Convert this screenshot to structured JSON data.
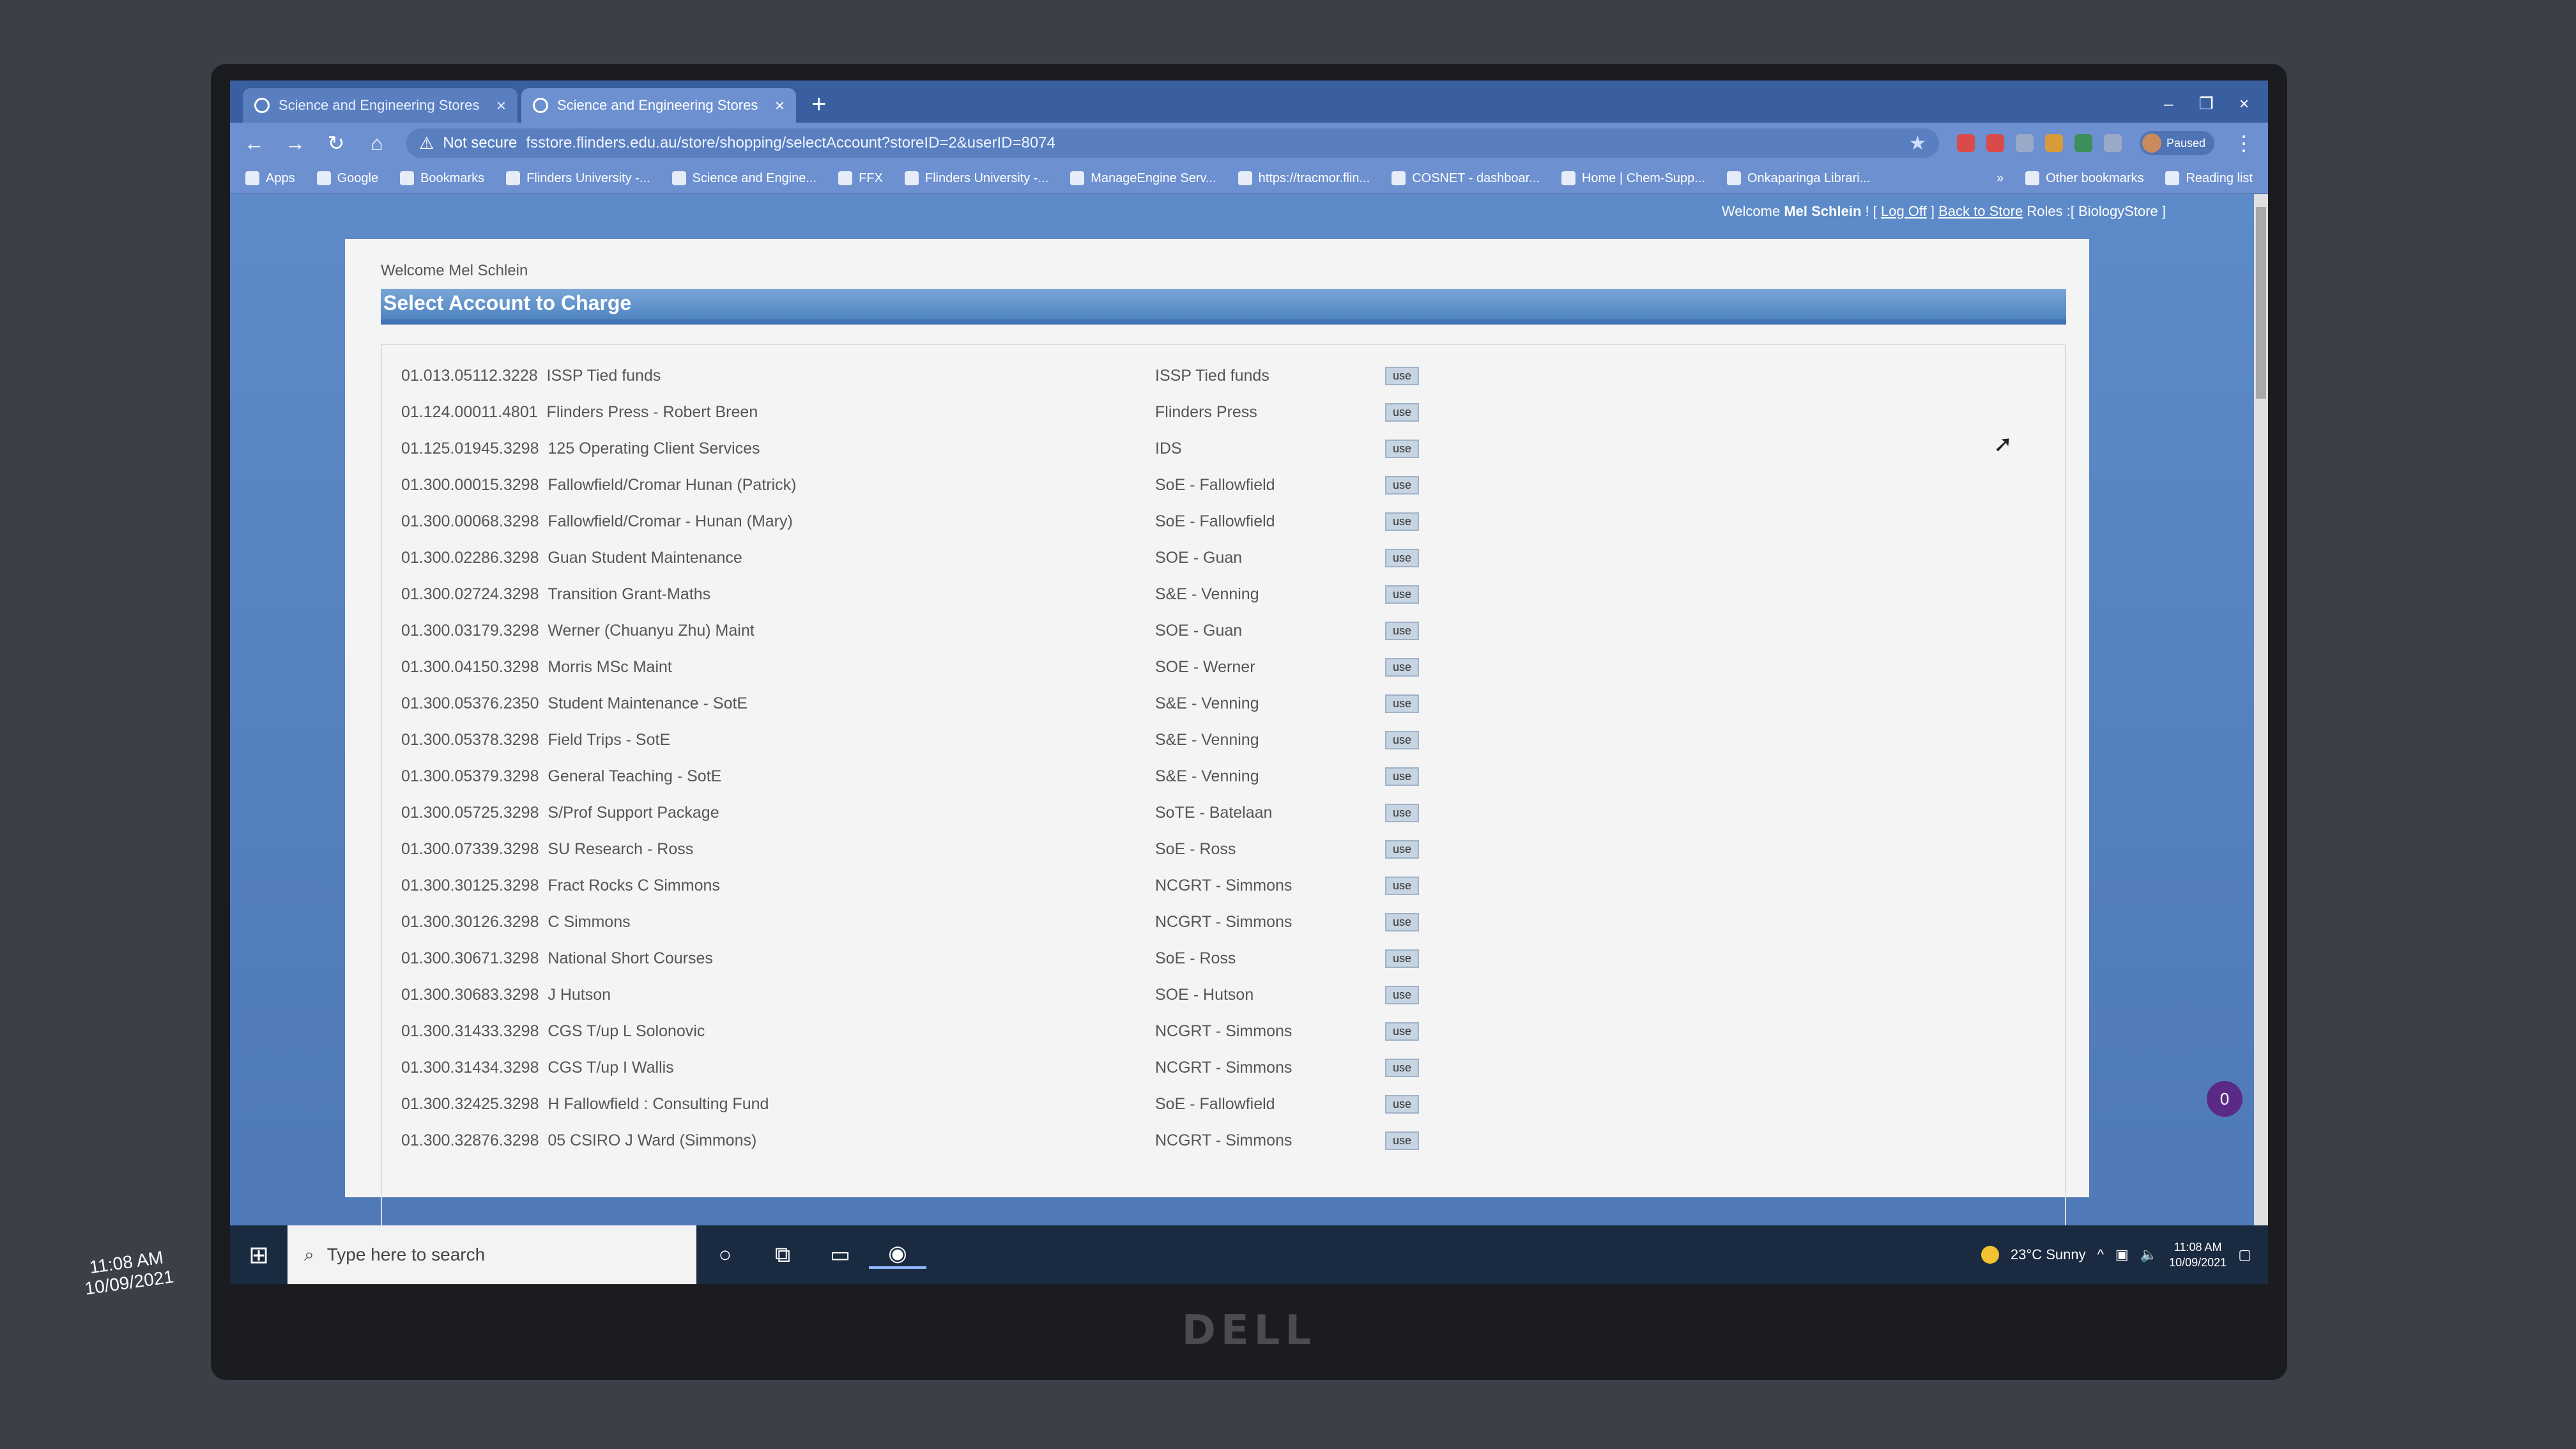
{
  "browser": {
    "tabs": [
      {
        "label": "Science and Engineering Stores",
        "close": "×"
      },
      {
        "label": "Science and Engineering Stores",
        "close": "×"
      }
    ],
    "new_tab": "+",
    "window_controls": [
      "–",
      "❐",
      "×"
    ],
    "security_label": "Not secure",
    "url": "fsstore.flinders.edu.au/store/shopping/selectAccount?storeID=2&userID=8074",
    "profile_label": "Paused",
    "bookmarks": [
      "Apps",
      "Google",
      "Bookmarks",
      "Flinders University -...",
      "Science and Engine...",
      "FFX",
      "Flinders University -...",
      "ManageEngine Serv...",
      "https://tracmor.flin...",
      "COSNET - dashboar...",
      "Home | Chem-Supp...",
      "Onkaparinga Librari..."
    ],
    "bookmarks_more": "»",
    "other_bookmarks": "Other bookmarks",
    "reading_list": "Reading list"
  },
  "header": {
    "welcome_prefix": "Welcome",
    "user": "Mel Schlein",
    "sep1": "! [",
    "logoff": "Log Off",
    "sep2": "]",
    "back_to_store": "Back to Store",
    "roles": "Roles :[ BiologyStore ]"
  },
  "panel": {
    "welcome": "Welcome Mel Schlein",
    "title": "Select Account to Charge",
    "use_label": "use",
    "accounts": [
      {
        "code": "01.013.05112.3228",
        "name": "ISSP Tied funds",
        "group": "ISSP Tied funds"
      },
      {
        "code": "01.124.00011.4801",
        "name": "Flinders Press - Robert Breen",
        "group": "Flinders Press"
      },
      {
        "code": "01.125.01945.3298",
        "name": "125 Operating Client Services",
        "group": "IDS"
      },
      {
        "code": "01.300.00015.3298",
        "name": "Fallowfield/Cromar Hunan (Patrick)",
        "group": "SoE - Fallowfield"
      },
      {
        "code": "01.300.00068.3298",
        "name": "Fallowfield/Cromar - Hunan (Mary)",
        "group": "SoE - Fallowfield"
      },
      {
        "code": "01.300.02286.3298",
        "name": "Guan Student Maintenance",
        "group": "SOE - Guan"
      },
      {
        "code": "01.300.02724.3298",
        "name": "Transition Grant-Maths",
        "group": "S&E - Venning"
      },
      {
        "code": "01.300.03179.3298",
        "name": "Werner (Chuanyu Zhu) Maint",
        "group": "SOE - Guan"
      },
      {
        "code": "01.300.04150.3298",
        "name": "Morris MSc Maint",
        "group": "SOE - Werner"
      },
      {
        "code": "01.300.05376.2350",
        "name": "Student Maintenance - SotE",
        "group": "S&E - Venning"
      },
      {
        "code": "01.300.05378.3298",
        "name": "Field Trips - SotE",
        "group": "S&E - Venning"
      },
      {
        "code": "01.300.05379.3298",
        "name": "General Teaching - SotE",
        "group": "S&E - Venning"
      },
      {
        "code": "01.300.05725.3298",
        "name": "S/Prof Support Package",
        "group": "SoTE - Batelaan"
      },
      {
        "code": "01.300.07339.3298",
        "name": "SU Research - Ross",
        "group": "SoE - Ross"
      },
      {
        "code": "01.300.30125.3298",
        "name": "Fract Rocks C Simmons",
        "group": "NCGRT - Simmons"
      },
      {
        "code": "01.300.30126.3298",
        "name": "C Simmons",
        "group": "NCGRT - Simmons"
      },
      {
        "code": "01.300.30671.3298",
        "name": "National Short Courses",
        "group": "SoE - Ross"
      },
      {
        "code": "01.300.30683.3298",
        "name": "J Hutson",
        "group": "SOE - Hutson"
      },
      {
        "code": "01.300.31433.3298",
        "name": "CGS T/up L Solonovic",
        "group": "NCGRT - Simmons"
      },
      {
        "code": "01.300.31434.3298",
        "name": "CGS T/up I Wallis",
        "group": "NCGRT - Simmons"
      },
      {
        "code": "01.300.32425.3298",
        "name": "H Fallowfield : Consulting Fund",
        "group": "SoE - Fallowfield"
      },
      {
        "code": "01.300.32876.3298",
        "name": "05 CSIRO J Ward (Simmons)",
        "group": "NCGRT - Simmons"
      }
    ],
    "notification_count": "0"
  },
  "taskbar": {
    "search_placeholder": "Type here to search",
    "weather": "23°C Sunny",
    "time": "11:08 AM",
    "date": "10/09/2021"
  },
  "left_monitor": {
    "time": "11:08 AM",
    "date": "10/09/2021"
  },
  "monitor_brand": "DELL"
}
